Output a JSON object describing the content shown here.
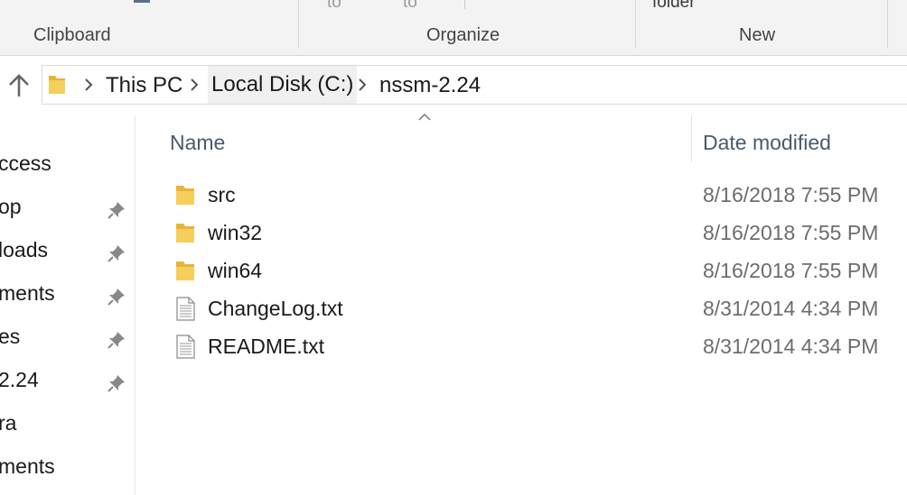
{
  "ribbon": {
    "fragments": [
      "to",
      "to",
      "folder"
    ],
    "groups": {
      "clipboard": "Clipboard",
      "organize": "Organize",
      "new": "New"
    }
  },
  "address": {
    "breadcrumbs": [
      "This PC",
      "Local Disk (C:)",
      "nssm-2.24"
    ]
  },
  "nav": {
    "items": [
      {
        "label": "ccess",
        "pinned": false
      },
      {
        "label": "op",
        "pinned": true
      },
      {
        "label": "loads",
        "pinned": true
      },
      {
        "label": "ments",
        "pinned": true
      },
      {
        "label": "es",
        "pinned": true
      },
      {
        "label": "2.24",
        "pinned": true
      },
      {
        "label": "ra",
        "pinned": false
      },
      {
        "label": "ments",
        "pinned": false
      }
    ]
  },
  "file_list": {
    "columns": {
      "name": "Name",
      "date_modified": "Date modified"
    },
    "rows": [
      {
        "icon": "folder-icon",
        "name": "src",
        "date": "8/16/2018 7:55 PM"
      },
      {
        "icon": "folder-icon",
        "name": "win32",
        "date": "8/16/2018 7:55 PM"
      },
      {
        "icon": "folder-icon",
        "name": "win64",
        "date": "8/16/2018 7:55 PM"
      },
      {
        "icon": "text-file-icon",
        "name": "ChangeLog.txt",
        "date": "8/31/2014 4:34 PM"
      },
      {
        "icon": "text-file-icon",
        "name": "README.txt",
        "date": "8/31/2014 4:34 PM"
      }
    ]
  },
  "colors": {
    "folder": "#f2c14e",
    "header_text": "#4a5a6e",
    "date_text": "#6d6d6d",
    "ribbon_bg": "#f3f3f3"
  }
}
